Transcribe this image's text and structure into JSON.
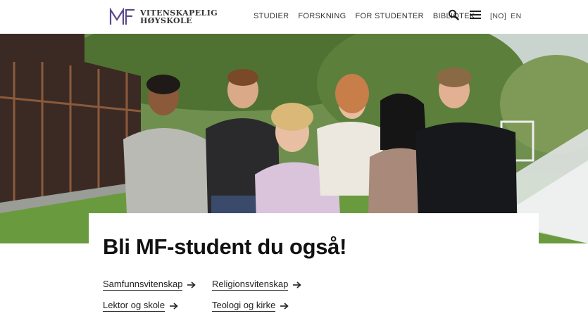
{
  "header": {
    "logo_line1": "VITENSKAPELIG",
    "logo_line2": "HØYSKOLE",
    "logo_mark_text": "MF",
    "nav": [
      {
        "label": "STUDIER"
      },
      {
        "label": "FORSKNING"
      },
      {
        "label": "FOR STUDENTER"
      },
      {
        "label": "BIBLIOTEK"
      }
    ],
    "search_icon": "search-icon",
    "menu_icon": "hamburger-menu-icon",
    "lang_no": "[NO]",
    "lang_en": "EN"
  },
  "hero": {
    "image": "group-of-six-students-outdoors",
    "accent_color": "#5b4a8a"
  },
  "card": {
    "title": "Bli MF-student du også!",
    "links": [
      {
        "label": "Samfunnsvitenskap"
      },
      {
        "label": "Religionsvitenskap"
      },
      {
        "label": "Lektor og skole"
      },
      {
        "label": "Teologi og kirke"
      }
    ]
  }
}
